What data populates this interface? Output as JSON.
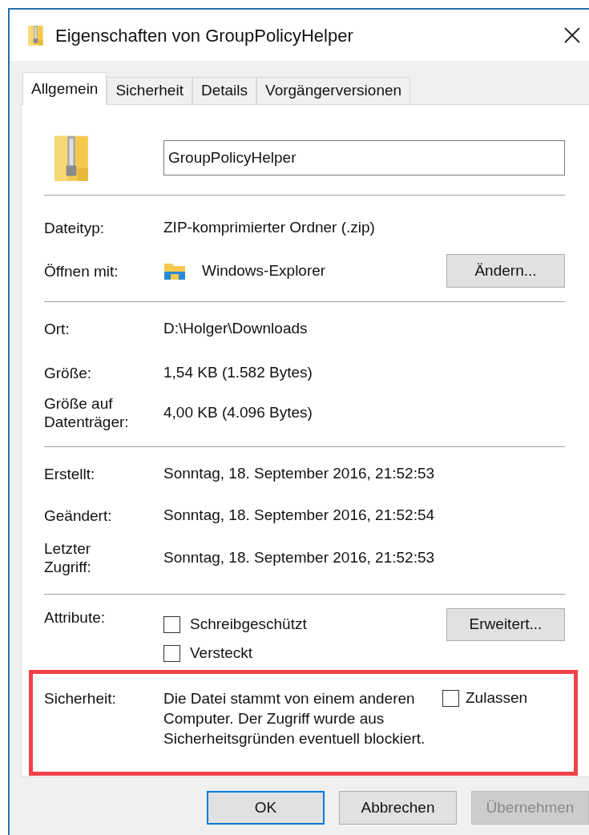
{
  "window": {
    "title": "Eigenschaften von GroupPolicyHelper"
  },
  "tabs": [
    {
      "label": "Allgemein",
      "selected": true
    },
    {
      "label": "Sicherheit",
      "selected": false
    },
    {
      "label": "Details",
      "selected": false
    },
    {
      "label": "Vorgängerversionen",
      "selected": false
    }
  ],
  "name_field": {
    "value": "GroupPolicyHelper"
  },
  "file_type": {
    "label": "Dateityp:",
    "value": "ZIP-komprimierter Ordner (.zip)"
  },
  "open_with": {
    "label": "Öffnen mit:",
    "value": "Windows-Explorer",
    "button": "Ändern..."
  },
  "location": [
    {
      "label": "Ort:",
      "value": "D:\\Holger\\Downloads"
    },
    {
      "label": "Größe:",
      "value": "1,54 KB (1.582 Bytes)"
    },
    {
      "label": "Größe auf Datenträger:",
      "value": "4,00 KB (4.096 Bytes)"
    }
  ],
  "dates": [
    {
      "label": "Erstellt:",
      "value": "Sonntag, 18. September 2016, 21:52:53"
    },
    {
      "label": "Geändert:",
      "value": "Sonntag, 18. September 2016, 21:52:54"
    },
    {
      "label": "Letzter Zugriff:",
      "value": "Sonntag, 18. September 2016, 21:52:53"
    }
  ],
  "attributes": {
    "label": "Attribute:",
    "button": "Erweitert...",
    "options": [
      {
        "label": "Schreibgeschützt",
        "checked": false
      },
      {
        "label": "Versteckt",
        "checked": false
      }
    ]
  },
  "security": {
    "label": "Sicherheit:",
    "text": "Die Datei stammt von einem anderen Computer. Der Zugriff wurde aus Sicherheitsgründen eventuell blockiert.",
    "highlighted": true,
    "option": {
      "label": "Zulassen",
      "checked": false
    }
  },
  "buttons": [
    {
      "label": "OK",
      "kind": "default"
    },
    {
      "label": "Abbrechen",
      "kind": "normal"
    },
    {
      "label": "Übernehmen",
      "kind": "disabled"
    }
  ]
}
